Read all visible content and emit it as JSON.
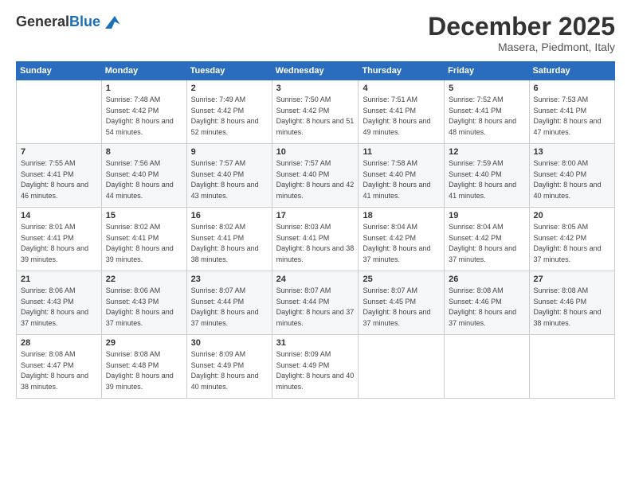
{
  "logo": {
    "general": "General",
    "blue": "Blue"
  },
  "title": "December 2025",
  "location": "Masera, Piedmont, Italy",
  "days_of_week": [
    "Sunday",
    "Monday",
    "Tuesday",
    "Wednesday",
    "Thursday",
    "Friday",
    "Saturday"
  ],
  "weeks": [
    [
      {
        "day": "",
        "sunrise": "",
        "sunset": "",
        "daylight": ""
      },
      {
        "day": "1",
        "sunrise": "Sunrise: 7:48 AM",
        "sunset": "Sunset: 4:42 PM",
        "daylight": "Daylight: 8 hours and 54 minutes."
      },
      {
        "day": "2",
        "sunrise": "Sunrise: 7:49 AM",
        "sunset": "Sunset: 4:42 PM",
        "daylight": "Daylight: 8 hours and 52 minutes."
      },
      {
        "day": "3",
        "sunrise": "Sunrise: 7:50 AM",
        "sunset": "Sunset: 4:42 PM",
        "daylight": "Daylight: 8 hours and 51 minutes."
      },
      {
        "day": "4",
        "sunrise": "Sunrise: 7:51 AM",
        "sunset": "Sunset: 4:41 PM",
        "daylight": "Daylight: 8 hours and 49 minutes."
      },
      {
        "day": "5",
        "sunrise": "Sunrise: 7:52 AM",
        "sunset": "Sunset: 4:41 PM",
        "daylight": "Daylight: 8 hours and 48 minutes."
      },
      {
        "day": "6",
        "sunrise": "Sunrise: 7:53 AM",
        "sunset": "Sunset: 4:41 PM",
        "daylight": "Daylight: 8 hours and 47 minutes."
      }
    ],
    [
      {
        "day": "7",
        "sunrise": "Sunrise: 7:55 AM",
        "sunset": "Sunset: 4:41 PM",
        "daylight": "Daylight: 8 hours and 46 minutes."
      },
      {
        "day": "8",
        "sunrise": "Sunrise: 7:56 AM",
        "sunset": "Sunset: 4:40 PM",
        "daylight": "Daylight: 8 hours and 44 minutes."
      },
      {
        "day": "9",
        "sunrise": "Sunrise: 7:57 AM",
        "sunset": "Sunset: 4:40 PM",
        "daylight": "Daylight: 8 hours and 43 minutes."
      },
      {
        "day": "10",
        "sunrise": "Sunrise: 7:57 AM",
        "sunset": "Sunset: 4:40 PM",
        "daylight": "Daylight: 8 hours and 42 minutes."
      },
      {
        "day": "11",
        "sunrise": "Sunrise: 7:58 AM",
        "sunset": "Sunset: 4:40 PM",
        "daylight": "Daylight: 8 hours and 41 minutes."
      },
      {
        "day": "12",
        "sunrise": "Sunrise: 7:59 AM",
        "sunset": "Sunset: 4:40 PM",
        "daylight": "Daylight: 8 hours and 41 minutes."
      },
      {
        "day": "13",
        "sunrise": "Sunrise: 8:00 AM",
        "sunset": "Sunset: 4:40 PM",
        "daylight": "Daylight: 8 hours and 40 minutes."
      }
    ],
    [
      {
        "day": "14",
        "sunrise": "Sunrise: 8:01 AM",
        "sunset": "Sunset: 4:41 PM",
        "daylight": "Daylight: 8 hours and 39 minutes."
      },
      {
        "day": "15",
        "sunrise": "Sunrise: 8:02 AM",
        "sunset": "Sunset: 4:41 PM",
        "daylight": "Daylight: 8 hours and 39 minutes."
      },
      {
        "day": "16",
        "sunrise": "Sunrise: 8:02 AM",
        "sunset": "Sunset: 4:41 PM",
        "daylight": "Daylight: 8 hours and 38 minutes."
      },
      {
        "day": "17",
        "sunrise": "Sunrise: 8:03 AM",
        "sunset": "Sunset: 4:41 PM",
        "daylight": "Daylight: 8 hours and 38 minutes."
      },
      {
        "day": "18",
        "sunrise": "Sunrise: 8:04 AM",
        "sunset": "Sunset: 4:42 PM",
        "daylight": "Daylight: 8 hours and 37 minutes."
      },
      {
        "day": "19",
        "sunrise": "Sunrise: 8:04 AM",
        "sunset": "Sunset: 4:42 PM",
        "daylight": "Daylight: 8 hours and 37 minutes."
      },
      {
        "day": "20",
        "sunrise": "Sunrise: 8:05 AM",
        "sunset": "Sunset: 4:42 PM",
        "daylight": "Daylight: 8 hours and 37 minutes."
      }
    ],
    [
      {
        "day": "21",
        "sunrise": "Sunrise: 8:06 AM",
        "sunset": "Sunset: 4:43 PM",
        "daylight": "Daylight: 8 hours and 37 minutes."
      },
      {
        "day": "22",
        "sunrise": "Sunrise: 8:06 AM",
        "sunset": "Sunset: 4:43 PM",
        "daylight": "Daylight: 8 hours and 37 minutes."
      },
      {
        "day": "23",
        "sunrise": "Sunrise: 8:07 AM",
        "sunset": "Sunset: 4:44 PM",
        "daylight": "Daylight: 8 hours and 37 minutes."
      },
      {
        "day": "24",
        "sunrise": "Sunrise: 8:07 AM",
        "sunset": "Sunset: 4:44 PM",
        "daylight": "Daylight: 8 hours and 37 minutes."
      },
      {
        "day": "25",
        "sunrise": "Sunrise: 8:07 AM",
        "sunset": "Sunset: 4:45 PM",
        "daylight": "Daylight: 8 hours and 37 minutes."
      },
      {
        "day": "26",
        "sunrise": "Sunrise: 8:08 AM",
        "sunset": "Sunset: 4:46 PM",
        "daylight": "Daylight: 8 hours and 37 minutes."
      },
      {
        "day": "27",
        "sunrise": "Sunrise: 8:08 AM",
        "sunset": "Sunset: 4:46 PM",
        "daylight": "Daylight: 8 hours and 38 minutes."
      }
    ],
    [
      {
        "day": "28",
        "sunrise": "Sunrise: 8:08 AM",
        "sunset": "Sunset: 4:47 PM",
        "daylight": "Daylight: 8 hours and 38 minutes."
      },
      {
        "day": "29",
        "sunrise": "Sunrise: 8:08 AM",
        "sunset": "Sunset: 4:48 PM",
        "daylight": "Daylight: 8 hours and 39 minutes."
      },
      {
        "day": "30",
        "sunrise": "Sunrise: 8:09 AM",
        "sunset": "Sunset: 4:49 PM",
        "daylight": "Daylight: 8 hours and 40 minutes."
      },
      {
        "day": "31",
        "sunrise": "Sunrise: 8:09 AM",
        "sunset": "Sunset: 4:49 PM",
        "daylight": "Daylight: 8 hours and 40 minutes."
      },
      {
        "day": "",
        "sunrise": "",
        "sunset": "",
        "daylight": ""
      },
      {
        "day": "",
        "sunrise": "",
        "sunset": "",
        "daylight": ""
      },
      {
        "day": "",
        "sunrise": "",
        "sunset": "",
        "daylight": ""
      }
    ]
  ]
}
